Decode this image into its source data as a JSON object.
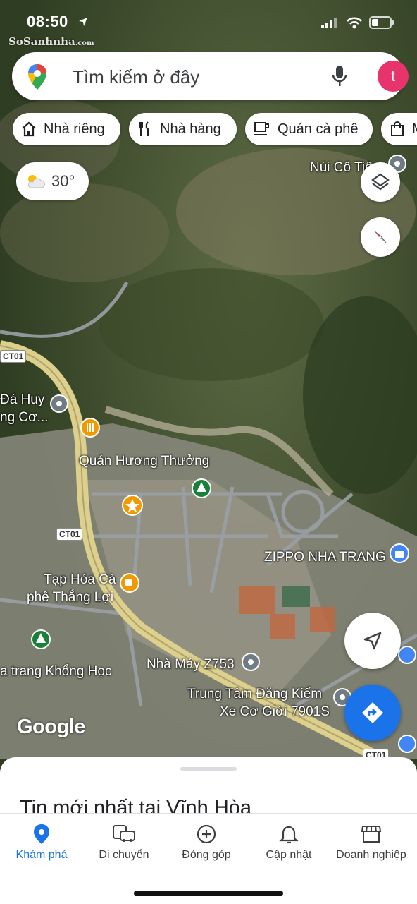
{
  "status_bar": {
    "time": "08:50",
    "watermark": "SoSanhnha",
    "watermark_domain": ".com"
  },
  "search": {
    "placeholder": "Tìm kiếm ở đây",
    "avatar_letter": "t"
  },
  "chips": [
    {
      "label": "Nhà riêng",
      "icon": "home-icon"
    },
    {
      "label": "Nhà hàng",
      "icon": "restaurant-icon"
    },
    {
      "label": "Quán cà phê",
      "icon": "coffee-icon"
    },
    {
      "label": "M",
      "icon": "shopping-bag-icon"
    }
  ],
  "weather": {
    "temperature": "30°",
    "icon": "partly-cloudy-icon"
  },
  "map": {
    "logo": "Google",
    "labels": {
      "nui_co_tien": "Núi Cô Tiên",
      "da_huy_1": "Đá Huy",
      "da_huy_2": "ng Cơ...",
      "quan_huong_thuong": "Quán Hương Thưởng",
      "zippo": "ZIPPO NHA TRANG",
      "tap_hoa_1": "Tạp Hóa Cà",
      "tap_hoa_2": "phê Thắng Lợi",
      "khong_hoc": "a trang Khổng Học",
      "nha_may": "Nhà Máy Z753",
      "trung_tam_1": "Trung Tâm Đăng Kiểm",
      "trung_tam_2": "Xe Cơ Giới 7901S"
    },
    "road_shields": {
      "a": "CT01",
      "b": "CT01",
      "c": "CT01"
    },
    "colors": {
      "satellite_green": "#3f5230",
      "road": "#d9cf8a",
      "accent_blue": "#1a73e8"
    }
  },
  "sheet": {
    "title": "Tin mới nhất tại Vĩnh Hòa"
  },
  "tabs": [
    {
      "label": "Khám phá",
      "icon": "location-pin-icon",
      "active": true
    },
    {
      "label": "Di chuyển",
      "icon": "commute-icon",
      "active": false
    },
    {
      "label": "Đóng góp",
      "icon": "add-circle-icon",
      "active": false
    },
    {
      "label": "Cập nhật",
      "icon": "bell-icon",
      "active": false
    },
    {
      "label": "Doanh nghiệp",
      "icon": "storefront-icon",
      "active": false
    }
  ]
}
